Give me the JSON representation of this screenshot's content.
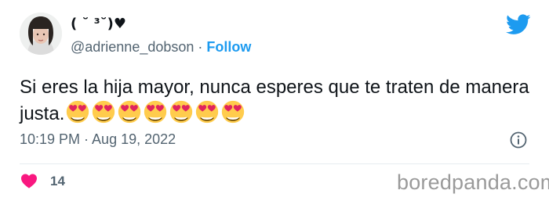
{
  "user": {
    "display_name": "( ˘ ³˘)♥",
    "handle": "@adrienne_dobson",
    "separator": "·",
    "follow_label": "Follow"
  },
  "tweet": {
    "text": "Si eres la hija mayor, nunca esperes que te traten de manera justa.",
    "emoji_name": "heart-eyes-emoji",
    "emoji_count_shown": 7,
    "timestamp": "10:19 PM · Aug 19, 2022"
  },
  "engagement": {
    "likes": "14"
  },
  "icons": {
    "twitter": "twitter-bird-icon",
    "info": "info-icon",
    "heart": "heart-icon"
  },
  "colors": {
    "twitter_blue": "#1d9bf0",
    "heart_pink": "#f91880",
    "secondary_text": "#536471"
  },
  "watermark": "boredpanda.com"
}
